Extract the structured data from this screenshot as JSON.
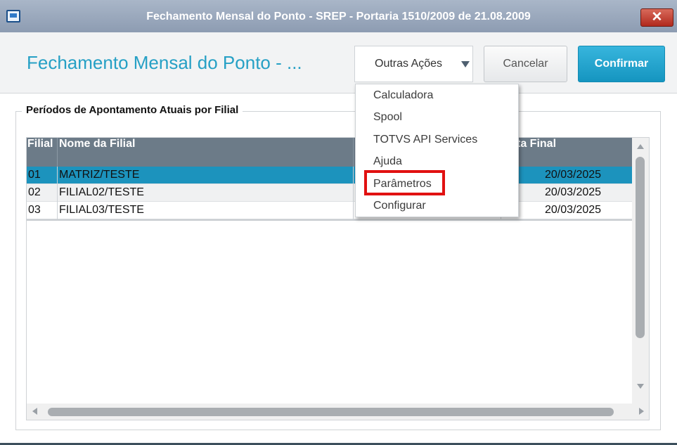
{
  "window": {
    "title": "Fechamento Mensal do Ponto - SREP - Portaria 1510/2009 de 21.08.2009",
    "close_symbol": "✕"
  },
  "header": {
    "page_title": "Fechamento Mensal do Ponto - ...",
    "other_actions_label": "Outras Ações",
    "cancel_label": "Cancelar",
    "confirm_label": "Confirmar"
  },
  "group": {
    "title": "Períodos de Apontamento Atuais por Filial"
  },
  "grid": {
    "columns": [
      "Filial",
      "Nome da Filial",
      "",
      "ta Final"
    ],
    "rows": [
      {
        "filial": "01",
        "nome": "MATRIZ/TESTE",
        "data_final": "20/03/2025"
      },
      {
        "filial": "02",
        "nome": "FILIAL02/TESTE",
        "data_final": "20/03/2025"
      },
      {
        "filial": "03",
        "nome": "FILIAL03/TESTE",
        "data_final": "20/03/2025"
      }
    ]
  },
  "menu": {
    "items": [
      "Calculadora",
      "Spool",
      "TOTVS API Services",
      "Ajuda",
      "Parâmetros",
      "Configurar"
    ]
  },
  "colors": {
    "accent": "#26a0c5",
    "selected_row": "#1c93bd",
    "grid_header": "#6c7b88",
    "highlight": "#e11111"
  },
  "icons": [
    "app-window-icon",
    "close-icon",
    "caret-down-icon",
    "scroll-up-icon",
    "scroll-down-icon",
    "scroll-left-icon",
    "scroll-right-icon"
  ]
}
